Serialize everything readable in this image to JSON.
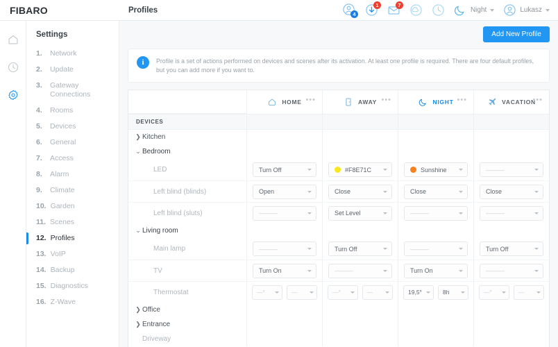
{
  "brand": "FIBARO",
  "page_title": "Profiles",
  "topbar": {
    "icons": [
      {
        "name": "users-icon",
        "badge": "4",
        "badge_color": "#1b7ee0"
      },
      {
        "name": "download-icon",
        "badge": "1",
        "badge_color": "#f03e2f"
      },
      {
        "name": "mail-icon",
        "badge": "7",
        "badge_color": "#f03e2f"
      },
      {
        "name": "cloud-icon",
        "badge": ""
      },
      {
        "name": "clock-icon",
        "badge": ""
      }
    ],
    "profile_selector": {
      "icon": "moon-icon",
      "label": "Night"
    },
    "user_selector": {
      "icon": "user-avatar-icon",
      "label": "Lukasz"
    }
  },
  "rail": {
    "items": [
      {
        "name": "home-icon",
        "active": false
      },
      {
        "name": "history-icon",
        "active": false
      },
      {
        "name": "settings-gear-icon",
        "active": true
      }
    ],
    "active_color": "#2196f3"
  },
  "nav": {
    "heading": "Settings",
    "items": [
      {
        "num": "1.",
        "label": "Network"
      },
      {
        "num": "2.",
        "label": "Update"
      },
      {
        "num": "3.",
        "label": "Gateway Connections"
      },
      {
        "num": "4.",
        "label": "Rooms"
      },
      {
        "num": "5.",
        "label": "Devices"
      },
      {
        "num": "6.",
        "label": "General"
      },
      {
        "num": "7.",
        "label": "Access"
      },
      {
        "num": "8.",
        "label": "Alarm"
      },
      {
        "num": "9.",
        "label": "Climate"
      },
      {
        "num": "10.",
        "label": "Garden"
      },
      {
        "num": "11.",
        "label": "Scenes"
      },
      {
        "num": "12.",
        "label": "Profiles"
      },
      {
        "num": "13.",
        "label": "VoIP"
      },
      {
        "num": "14.",
        "label": "Backup"
      },
      {
        "num": "15.",
        "label": "Diagnostics"
      },
      {
        "num": "16.",
        "label": "Z-Wave"
      }
    ],
    "active_index": 11
  },
  "toolbar": {
    "add_profile_label": "Add New Profile",
    "accent": "#2196f3"
  },
  "info": {
    "icon": "info-icon",
    "text": "Profile is a set of actions performed on devices and scenes after its activation. At least one profile is required. There are four default profiles, but you can add more if you want to."
  },
  "table": {
    "section_label": "DEVICES",
    "columns": [
      {
        "label": "HOME",
        "icon": "house-icon",
        "active": false
      },
      {
        "label": "AWAY",
        "icon": "door-icon",
        "active": false
      },
      {
        "label": "NIGHT",
        "icon": "moon-icon",
        "active": true
      },
      {
        "label": "VACATION",
        "icon": "plane-icon",
        "active": false
      }
    ],
    "menu_glyph": "•••",
    "empty_value": "———",
    "rows": [
      {
        "kind": "group",
        "label": "Kitchen",
        "expanded": false,
        "chevron": "❯"
      },
      {
        "kind": "group",
        "label": "Bedroom",
        "expanded": true,
        "chevron": "⌄"
      },
      {
        "kind": "device",
        "label": "LED",
        "cells": [
          {
            "type": "select",
            "value": "Turn Off"
          },
          {
            "type": "select",
            "value": "#F8E71C",
            "swatch": "#F8E71C"
          },
          {
            "type": "select",
            "value": "Sunshine",
            "swatch": "#F5821F"
          },
          {
            "type": "select",
            "value": "",
            "empty": true
          }
        ]
      },
      {
        "kind": "device",
        "label": "Left blind (blinds)",
        "cells": [
          {
            "type": "select",
            "value": "Open"
          },
          {
            "type": "select",
            "value": "Close"
          },
          {
            "type": "select",
            "value": "Close"
          },
          {
            "type": "select",
            "value": "Close"
          }
        ]
      },
      {
        "kind": "device",
        "label": "Left blind (sluts)",
        "cells": [
          {
            "type": "select",
            "value": "",
            "empty": true
          },
          {
            "type": "select",
            "value": "Set Level"
          },
          {
            "type": "select",
            "value": "",
            "empty": true
          },
          {
            "type": "select",
            "value": "",
            "empty": true
          }
        ]
      },
      {
        "kind": "group",
        "label": "Living room",
        "expanded": true,
        "chevron": "⌄"
      },
      {
        "kind": "device",
        "label": "Main lamp",
        "cells": [
          {
            "type": "select",
            "value": "",
            "empty": true
          },
          {
            "type": "select",
            "value": "Turn Off"
          },
          {
            "type": "select",
            "value": "",
            "empty": true
          },
          {
            "type": "select",
            "value": "Turn Off"
          }
        ]
      },
      {
        "kind": "device",
        "label": "TV",
        "cells": [
          {
            "type": "select",
            "value": "Turn On"
          },
          {
            "type": "select",
            "value": "",
            "empty": true
          },
          {
            "type": "select",
            "value": "Turn On"
          },
          {
            "type": "select",
            "value": "",
            "empty": true
          }
        ]
      },
      {
        "kind": "device",
        "label": "Thermostat",
        "cells": [
          {
            "type": "pair",
            "a": "—°",
            "b": "—",
            "a_empty": true,
            "b_empty": true
          },
          {
            "type": "pair",
            "a": "—°",
            "b": "—",
            "a_empty": true,
            "b_empty": true
          },
          {
            "type": "pair",
            "a": "19,5°",
            "b": "8h",
            "a_empty": false,
            "b_empty": false
          },
          {
            "type": "pair",
            "a": "—°",
            "b": "—",
            "a_empty": true,
            "b_empty": true
          }
        ]
      },
      {
        "kind": "group",
        "label": "Office",
        "expanded": false,
        "chevron": "❯"
      },
      {
        "kind": "group",
        "label": "Entrance",
        "expanded": false,
        "chevron": "❯"
      },
      {
        "kind": "device-plain",
        "label": "Driveway",
        "cells": []
      }
    ]
  }
}
